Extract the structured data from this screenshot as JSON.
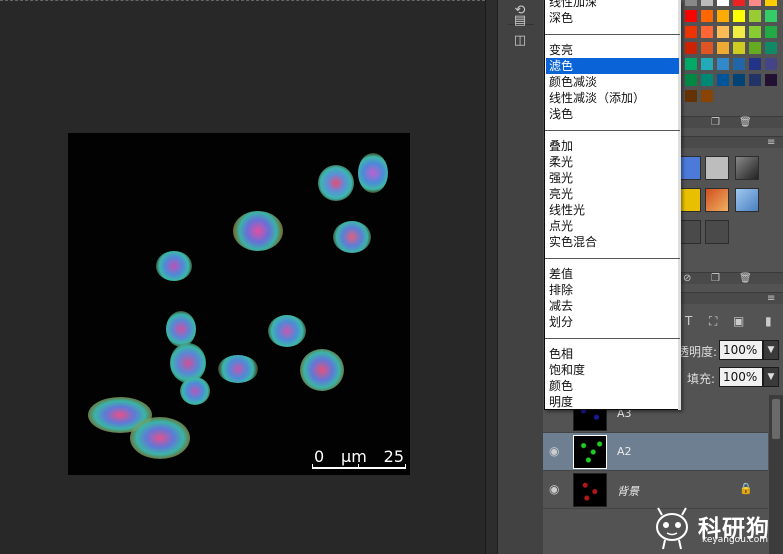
{
  "blend_menu": {
    "groups": [
      [
        "线性加深",
        "深色"
      ],
      [
        "变亮",
        "滤色",
        "颜色减淡",
        "线性减淡（添加）",
        "浅色"
      ],
      [
        "叠加",
        "柔光",
        "强光",
        "亮光",
        "线性光",
        "点光",
        "实色混合"
      ],
      [
        "差值",
        "排除",
        "减去",
        "划分"
      ],
      [
        "色相",
        "饱和度",
        "颜色",
        "明度"
      ]
    ],
    "selected": "滤色"
  },
  "image": {
    "scale_min": "0",
    "scale_unit": "µm",
    "scale_max": "25"
  },
  "layer_props": {
    "opacity_label": "透明度:",
    "opacity_value": "100%",
    "fill_label": "填充:",
    "fill_value": "100%"
  },
  "layers": [
    {
      "name": "A3",
      "visible": false,
      "active": false,
      "color": "#2a2adf",
      "locked": false
    },
    {
      "name": "A2",
      "visible": true,
      "active": true,
      "color": "#22cc22",
      "locked": false
    },
    {
      "name": "背景",
      "visible": true,
      "active": false,
      "color": "#cc2222",
      "locked": true
    }
  ],
  "logo": {
    "text": "科研狗",
    "sub": "keyangou.com"
  },
  "icons": {
    "lock": "lock-icon",
    "eye": "eye-icon",
    "trash": "trash-icon",
    "new": "new-layer-icon"
  },
  "colors": {
    "selection": "#0a64d8",
    "panel_bg": "#535353",
    "layer_active": "#6f7f92"
  }
}
